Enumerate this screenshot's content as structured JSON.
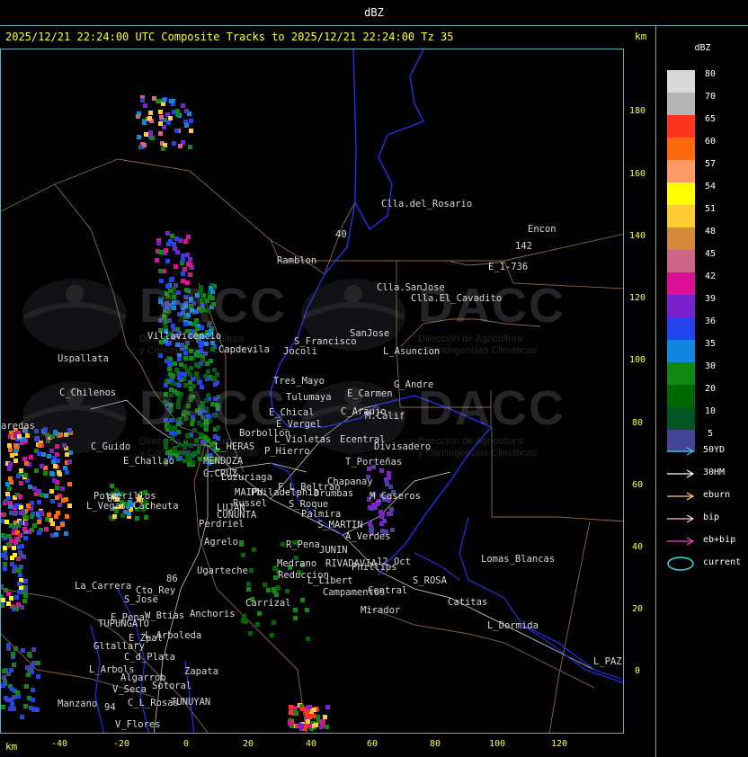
{
  "window_title": "dBZ",
  "header": {
    "line": "2025/12/21 22:24:00 UTC Composite Tracks to 2025/12/21 22:24:00 Tz 35",
    "km_top": "km",
    "km_bottom": "km"
  },
  "y_axis_ticks": [
    "180",
    "160",
    "140",
    "120",
    "100",
    "80",
    "60",
    "40",
    "20",
    "0"
  ],
  "x_axis_ticks": [
    "-40",
    "-20",
    "0",
    "20",
    "40",
    "60",
    "80",
    "100",
    "120"
  ],
  "legend": {
    "unit": "dBZ",
    "scale": [
      {
        "label": "80",
        "color": "#d9d9d9"
      },
      {
        "label": "70",
        "color": "#b5b5b5"
      },
      {
        "label": "65",
        "color": "#ff3322"
      },
      {
        "label": "60",
        "color": "#ff6a10"
      },
      {
        "label": "57",
        "color": "#ff9966"
      },
      {
        "label": "54",
        "color": "#ffff00"
      },
      {
        "label": "51",
        "color": "#ffcc33"
      },
      {
        "label": "48",
        "color": "#d4883a"
      },
      {
        "label": "45",
        "color": "#cc6688"
      },
      {
        "label": "42",
        "color": "#dd1199"
      },
      {
        "label": "39",
        "color": "#7722cc"
      },
      {
        "label": "36",
        "color": "#2244ee"
      },
      {
        "label": "35",
        "color": "#1188dd"
      },
      {
        "label": "30",
        "color": "#118811"
      },
      {
        "label": "20",
        "color": "#006600"
      },
      {
        "label": "10",
        "color": "#005522"
      },
      {
        "label": "5",
        "color": "#444499"
      }
    ],
    "tracks": [
      {
        "label": "50YD",
        "color": "#33cccc"
      },
      {
        "label": "30HM",
        "color": "#ffffff"
      },
      {
        "label": "eburn",
        "color": "#ffcc88"
      },
      {
        "label": "bip",
        "color": "#ffcccc"
      },
      {
        "label": "eb+bip",
        "color": "#ee44cc"
      }
    ],
    "current_label": "current",
    "current_color": "#33dddd"
  },
  "watermark": {
    "brand": "DACC",
    "subtitle_1": "Dirección de Agricultura",
    "subtitle_2": "y Contingencias Climáticas"
  },
  "places": [
    "Clla.del_Rosario",
    "Encon",
    "142",
    "E_1-736",
    "Ramblon",
    "Clla.SanJose",
    "Clla.El_Cavadito",
    "Villavicencio",
    "Capdevila",
    "S_Francisco",
    "SanJose",
    "L_Asuncion",
    "Uspallata",
    "Jocoli",
    "Tres_Mayo",
    "G_Andre",
    "E_Carmen",
    "C_Chilenos",
    "Tulumaya",
    "C_Araujo",
    "M.Calif",
    "E_Chical",
    "E_Vergel",
    "Borbollon",
    "Ecentral",
    "Divisadero",
    "aredas",
    "L_Violetas",
    "C_Guido",
    "L_HERAS",
    "P_Hierro",
    "E_Challao",
    "MENDOZA",
    "T_Porteñas",
    "G.CRUZ",
    "Luzuriaga",
    "Chapanay",
    "F_L_Beltran",
    "Philadelphia",
    "MAIPU",
    "Russel",
    "Drumbas",
    "M_Caseros",
    "Potrerillos",
    "Cacheuta",
    "L_Vegas",
    "LUJAN",
    "S_Roque",
    "CUNUNTA",
    "Palmira",
    "Perdriel",
    "S_MARTIN",
    "A_Verdes",
    "Agrelo",
    "R_Pena",
    "JUNIN",
    "Ugarteche",
    "Medrano",
    "RIVADAVIA",
    "12_Oct",
    "Lomas_Blancas",
    "Reduccion",
    "L_Libert",
    "Phillips",
    "S_ROSA",
    "La_Carrera",
    "Cto_Rey",
    "Campamentos",
    "Central",
    "S_Jose",
    "Carrizal",
    "Catitas",
    "E_Pena",
    "W_Btias",
    "Anchoris",
    "Mirador",
    "TUPUNGATO",
    "L_Dormida",
    "L_Arboleda",
    "E_Zpal",
    "Gltallary",
    "C_d_Plata",
    "L_PAZ",
    "L_Arbols",
    "Zapata",
    "Algarrob",
    "V_Seca",
    "Sotoral",
    "Manzano",
    "C_L_Rosas",
    "TUNUYAN",
    "V_Flores",
    "40",
    "88",
    "86",
    "94",
    "48"
  ]
}
